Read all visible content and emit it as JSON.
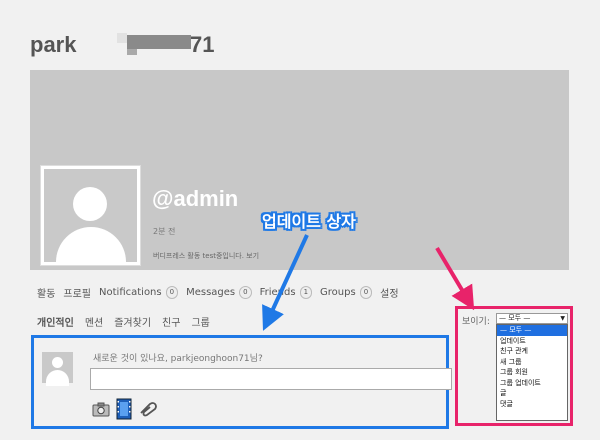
{
  "profile": {
    "name_part1": "park",
    "name_part2": "71",
    "handle": "@admin",
    "last_active": "2분 전",
    "latest_status": "버디프레스 활동 test중입니다. 보기"
  },
  "nav": {
    "items": [
      {
        "label": "활동"
      },
      {
        "label": "프로필"
      },
      {
        "label": "Notifications",
        "count": "0"
      },
      {
        "label": "Messages",
        "count": "0"
      },
      {
        "label": "Friends",
        "count": "1"
      },
      {
        "label": "Groups",
        "count": "0"
      },
      {
        "label": "설정"
      }
    ]
  },
  "subnav": {
    "items": [
      "개인적인",
      "멘션",
      "즐겨찾기",
      "친구",
      "그룹"
    ]
  },
  "post_form": {
    "prompt": "새로운 것이 있나요, parkjeonghoon71님?",
    "input_value": "",
    "icons": [
      "camera-icon",
      "film-icon",
      "paperclip-icon"
    ]
  },
  "annotation": {
    "label": "업데이트 상자",
    "colors": {
      "blue": "#1f79e6",
      "pink": "#e8236a"
    }
  },
  "filter": {
    "label": "보이기:",
    "selected": "— 모두 —",
    "options": [
      "— 모두 —",
      "업데이트",
      "친구 관계",
      "새 그룹",
      "그룹 회원",
      "그룹 업데이트",
      "글",
      "댓글"
    ]
  }
}
